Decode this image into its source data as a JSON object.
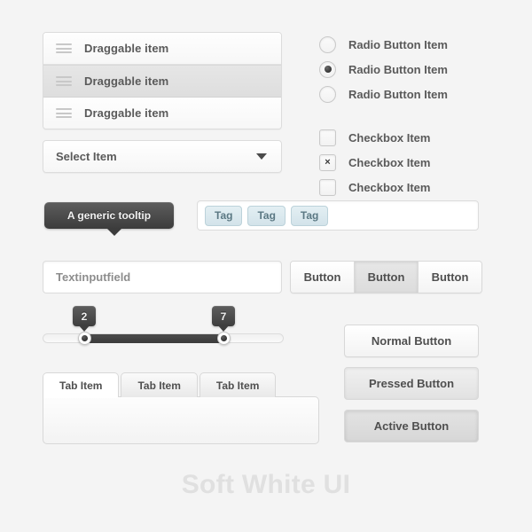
{
  "page": {
    "background": "#f4f4f4",
    "footer_title": "Soft White UI"
  },
  "draggable_list": {
    "handle_icon": "drag-handle-icon",
    "items": [
      {
        "label": "Draggable item",
        "selected": false
      },
      {
        "label": "Draggable item",
        "selected": true
      },
      {
        "label": "Draggable item",
        "selected": false
      }
    ]
  },
  "select": {
    "value": "Select Item",
    "arrow_icon": "chevron-down-icon"
  },
  "radios": {
    "items": [
      {
        "label": "Radio Button Item",
        "checked": false
      },
      {
        "label": "Radio Button Item",
        "checked": true
      },
      {
        "label": "Radio Button Item",
        "checked": false
      }
    ]
  },
  "checkboxes": {
    "check_glyph": "×",
    "items": [
      {
        "label": "Checkbox Item",
        "checked": false
      },
      {
        "label": "Checkbox Item",
        "checked": true
      },
      {
        "label": "Checkbox Item",
        "checked": false
      }
    ]
  },
  "tooltip": {
    "text": "A generic tooltip",
    "background": "#3c3c3c"
  },
  "tags": {
    "items": [
      "Tag",
      "Tag",
      "Tag"
    ],
    "color": "#5b7883",
    "background": "#d3e3ea"
  },
  "text_input": {
    "value": "Textinputfield"
  },
  "button_group": {
    "buttons": [
      {
        "label": "Button",
        "state": "normal"
      },
      {
        "label": "Button",
        "state": "pressed"
      },
      {
        "label": "Button",
        "state": "normal"
      }
    ]
  },
  "slider": {
    "min_value": "2",
    "max_value": "7",
    "range_color": "#3b3b3b"
  },
  "tabs": {
    "items": [
      {
        "label": "Tab Item",
        "active": true
      },
      {
        "label": "Tab Item",
        "active": false
      },
      {
        "label": "Tab Item",
        "active": false
      }
    ],
    "panel_content": ""
  },
  "state_buttons": [
    {
      "label": "Normal Button"
    },
    {
      "label": "Pressed Button"
    },
    {
      "label": "Active Button"
    }
  ]
}
